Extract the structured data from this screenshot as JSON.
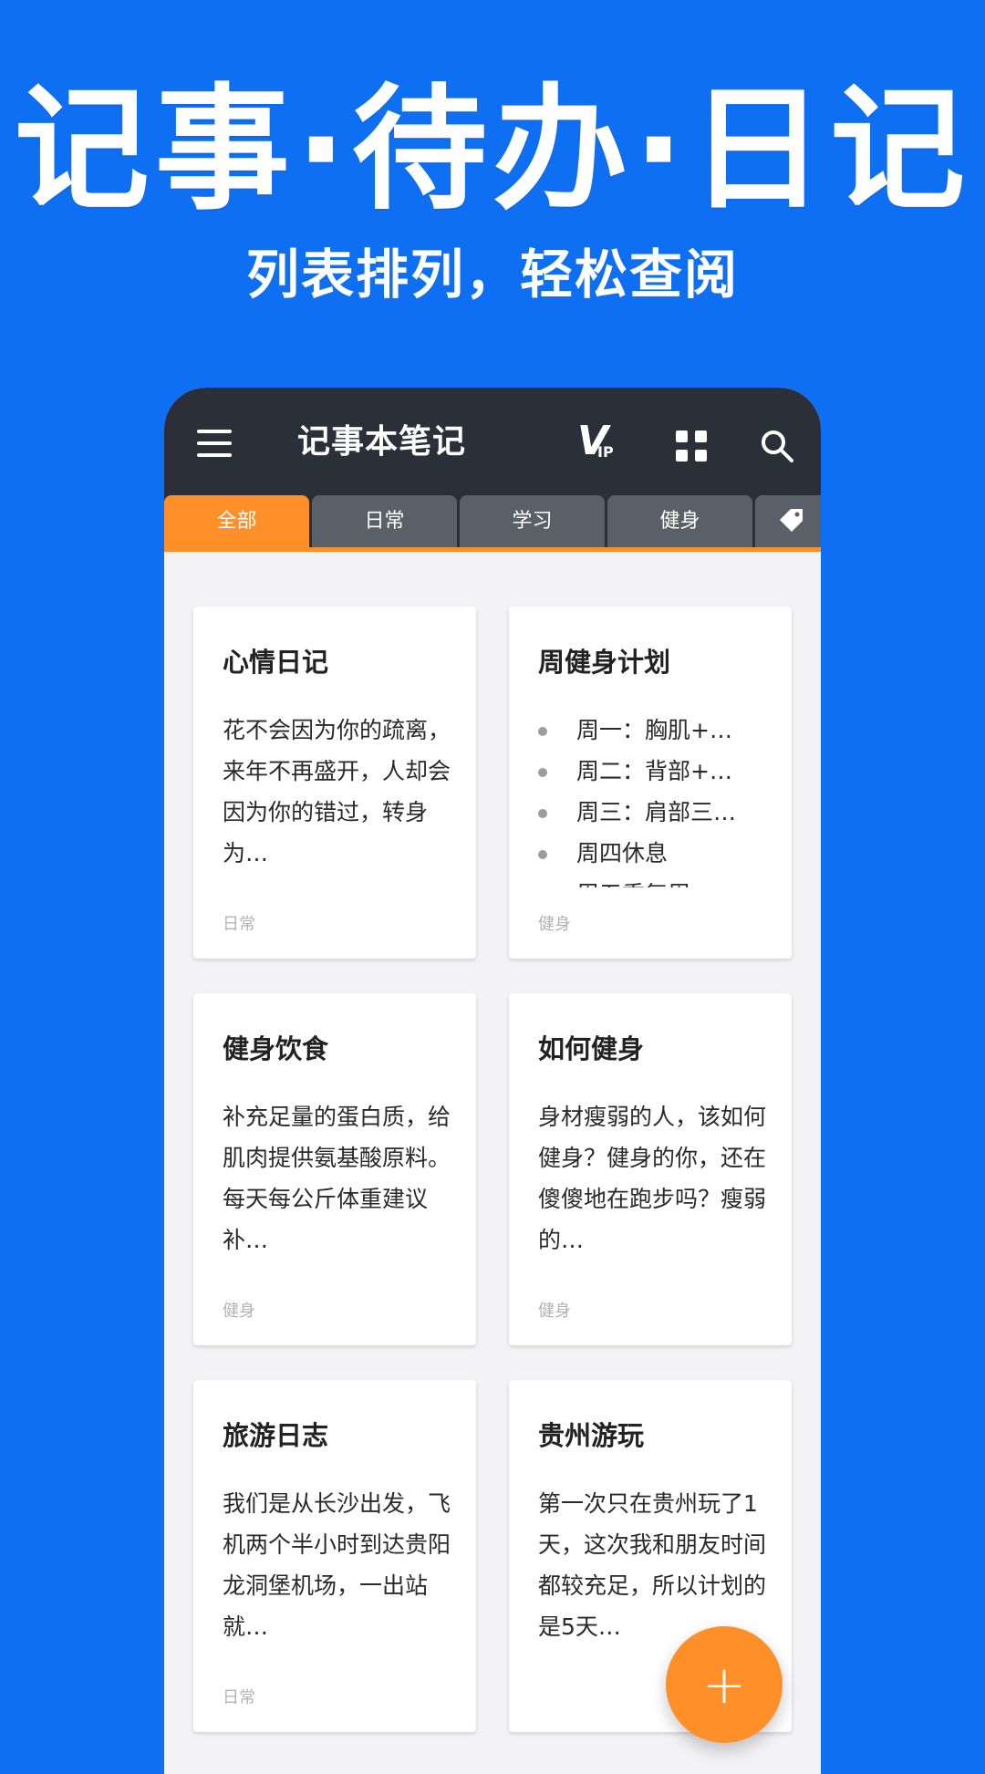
{
  "hero": {
    "title": "记事·待办·日记",
    "subtitle": "列表排列，轻松查阅"
  },
  "app": {
    "title": "记事本笔记",
    "icons": {
      "menu": "menu-icon",
      "vip": "vip-icon",
      "grid": "grid-icon",
      "search": "search-icon",
      "tag": "tag-icon",
      "add": "plus-icon"
    },
    "vip_big": "V",
    "vip_small": "IP",
    "fab_symbol": "+"
  },
  "tabs": [
    {
      "label": "全部",
      "active": true
    },
    {
      "label": "日常",
      "active": false
    },
    {
      "label": "学习",
      "active": false
    },
    {
      "label": "健身",
      "active": false
    }
  ],
  "cards": [
    {
      "title": "心情日记",
      "text": "花不会因为你的疏离，来年不再盛开，人却会因为你的错过，转身为…",
      "tag": "日常"
    },
    {
      "title": "周健身计划",
      "list": [
        "周一：胸肌+…",
        "周二：背部+…",
        "周三：肩部三…",
        "周四休息",
        "周五重复周一"
      ],
      "tag": "健身"
    },
    {
      "title": "健身饮食",
      "text": "补充足量的蛋白质，给肌肉提供氨基酸原料。每天每公斤体重建议补…",
      "tag": "健身"
    },
    {
      "title": "如何健身",
      "text": "身材瘦弱的人，该如何健身？健身的你，还在傻傻地在跑步吗？瘦弱的…",
      "tag": "健身"
    },
    {
      "title": "旅游日志",
      "text": "我们是从长沙出发，飞机两个半小时到达贵阳龙洞堡机场，一出站就…",
      "tag": "日常"
    },
    {
      "title": "贵州游玩",
      "text": "第一次只在贵州玩了1天，这次我和朋友时间都较充足，所以计划的是5天…",
      "tag": ""
    }
  ],
  "colors": {
    "background": "#0f6ff2",
    "appbar": "#2b3038",
    "accent": "#ff8f28",
    "tab_inactive": "#5a6068"
  }
}
